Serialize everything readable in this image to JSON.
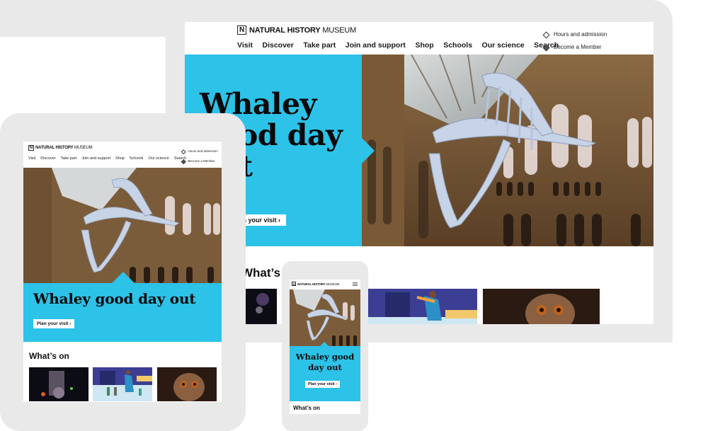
{
  "site": {
    "logo_bold": "NATURAL HISTORY",
    "logo_light": "MUSEUM",
    "logo_mark": "N"
  },
  "nav": {
    "items": [
      "Visit",
      "Discover",
      "Take part",
      "Join and support",
      "Shop",
      "Schools",
      "Our science",
      "Search"
    ]
  },
  "utility": {
    "hours": "Hours and admission",
    "member": "Become a Member"
  },
  "hero": {
    "title": "Whaley good day out",
    "title_laptop": "Whaley good day out",
    "title_phone": "Whaley good day out",
    "button_label": "Plan your visit",
    "button_arrow": "›",
    "accent_color": "#2dc2e8"
  },
  "whats_on": {
    "heading": "What’s on",
    "cards": [
      {
        "subject": "fireworks-light-show"
      },
      {
        "subject": "ice-skating-illustration"
      },
      {
        "subject": "tarsier-animal"
      }
    ]
  },
  "devices": [
    "laptop",
    "tablet",
    "phone"
  ]
}
